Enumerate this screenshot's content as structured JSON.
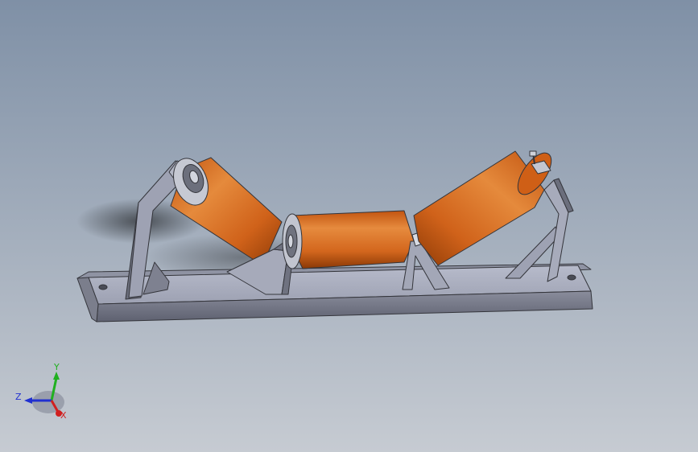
{
  "viewport": {
    "background_top": "#7f90a6",
    "background_bottom": "#c6cbd2"
  },
  "model": {
    "roller_color": "#d9691a",
    "roller_shadow": "#8d3a06",
    "frame_color": "#a9adbe",
    "frame_dark": "#6b6e7c",
    "frame_edge": "#34353b"
  },
  "triad": {
    "y_label": "Y",
    "z_label": "Z",
    "x_label": "X",
    "y_color": "#20b020",
    "z_color": "#2030d0",
    "x_color": "#d02020"
  }
}
